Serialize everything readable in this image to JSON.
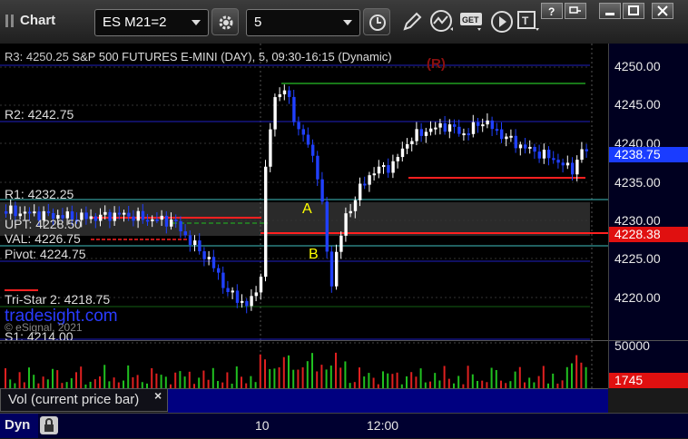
{
  "toolbar": {
    "title": "Chart",
    "symbol": "ES M21=2",
    "interval": "5"
  },
  "chart": {
    "header_prefix": "R3: 4250.25",
    "header": "S&P 500 FUTURES E-MINI (DAY), 5, 09:30-16:15 (Dynamic)",
    "r_marker": "(R)",
    "levels": [
      {
        "label": "R2: 4242.75"
      },
      {
        "label": "R1: 4232.25"
      },
      {
        "label": "UPT: 4228.50"
      },
      {
        "label": "VAL: 4226.75"
      },
      {
        "label": "Pivot: 4224.75"
      },
      {
        "label": "Tri-Star 2: 4218.75"
      },
      {
        "label": "S1: 4214.00"
      }
    ],
    "watermark": "tradesight.com",
    "copyright": "© eSignal, 2021",
    "markers": [
      {
        "text": "A"
      },
      {
        "text": "B"
      }
    ],
    "colors": {
      "up_bar": "#ffffff",
      "down_bar": "#2040ff",
      "pivot_line": "#2020c0",
      "r1_line": "#40c0c0",
      "resistance_red": "#ff2020",
      "green_line": "#20a020",
      "marker_yellow": "#ffff00"
    }
  },
  "price_axis": {
    "ticks": [
      "4250.00",
      "4245.00",
      "4240.00",
      "4235.00",
      "4230.00",
      "4225.00",
      "4220.00"
    ],
    "last_price": "4238.75",
    "level_price": "4228.38",
    "last_price_color": "#1a3cff",
    "level_price_color": "#e01010"
  },
  "volume": {
    "pane_label": "Vol (current price bar)",
    "close_glyph": "×",
    "tick": "50000",
    "current": "1745"
  },
  "time_axis": {
    "ticks": [
      "10",
      "12:00"
    ],
    "mode_label": "Dyn"
  }
}
